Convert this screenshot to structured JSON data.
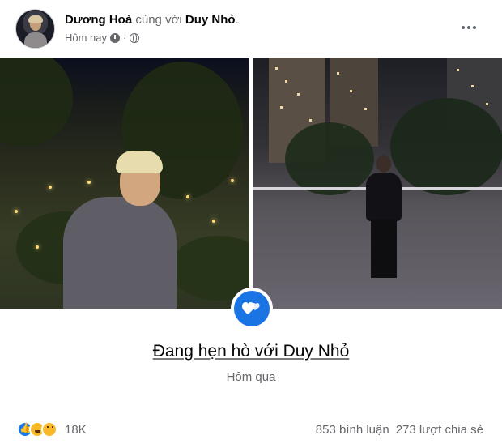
{
  "post": {
    "author": "Dương Hoà",
    "with_text": "cùng với",
    "tagged": "Duy Nhỏ",
    "tagged_suffix": ".",
    "time": "Hôm nay",
    "separator": "·",
    "icons": [
      "clock-icon",
      "globe-icon"
    ]
  },
  "event": {
    "icon": "double-heart-icon",
    "title": "Đang hẹn hò với Duy Nhỏ",
    "date": "Hôm qua"
  },
  "footer": {
    "reactions": [
      "like",
      "haha",
      "sad"
    ],
    "reaction_count": "18K",
    "comments": "853 bình luận",
    "shares": "273 lượt chia sẻ"
  },
  "colors": {
    "accent": "#1b74e4",
    "text": "#050505",
    "muted": "#65676b"
  }
}
